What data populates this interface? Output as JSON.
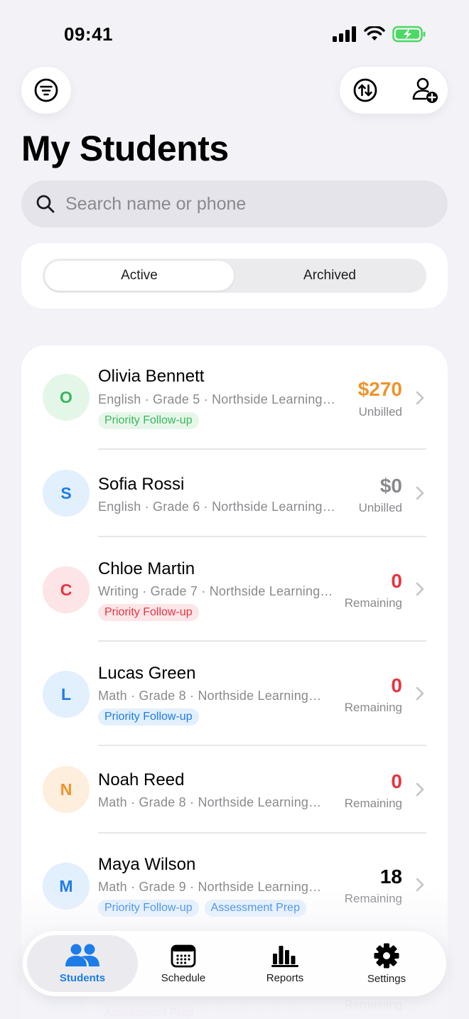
{
  "status": {
    "time": "09:41"
  },
  "header": {
    "title": "My Students"
  },
  "search": {
    "placeholder": "Search name or phone"
  },
  "segments": {
    "active": "Active",
    "archived": "Archived"
  },
  "students": [
    {
      "initial": "O",
      "name": "Olivia Bennett",
      "details": "English · Grade 5 · Northside Learning…",
      "tags": [
        "Priority Follow-up"
      ],
      "amount": "$270",
      "amount_label": "Unbilled"
    },
    {
      "initial": "S",
      "name": "Sofia Rossi",
      "details": "English · Grade 6 · Northside Learning…",
      "tags": [],
      "amount": "$0",
      "amount_label": "Unbilled"
    },
    {
      "initial": "C",
      "name": "Chloe Martin",
      "details": "Writing · Grade 7 · Northside Learning…",
      "tags": [
        "Priority Follow-up"
      ],
      "amount": "0",
      "amount_label": "Remaining"
    },
    {
      "initial": "L",
      "name": "Lucas Green",
      "details": "Math · Grade 8 · Northside Learning…",
      "tags": [
        "Priority Follow-up"
      ],
      "amount": "0",
      "amount_label": "Remaining"
    },
    {
      "initial": "N",
      "name": "Noah Reed",
      "details": "Math · Grade 8 · Northside Learning…",
      "tags": [],
      "amount": "0",
      "amount_label": "Remaining"
    },
    {
      "initial": "M",
      "name": "Maya Wilson",
      "details": "Math · Grade 9 · Northside Learning…",
      "tags": [
        "Priority Follow-up",
        "Assessment Prep"
      ],
      "amount": "18",
      "amount_label": "Remaining"
    }
  ],
  "partial_row": {
    "tag": "Assessment Prep",
    "amount_label": "Remaining"
  },
  "tabs": [
    {
      "label": "Students",
      "icon": "people-icon"
    },
    {
      "label": "Schedule",
      "icon": "calendar-icon"
    },
    {
      "label": "Reports",
      "icon": "bar-chart-icon"
    },
    {
      "label": "Settings",
      "icon": "gear-icon"
    }
  ],
  "colors": {
    "accent": "#1e7ce8",
    "orange": "#f0932b",
    "red": "#e8343f",
    "gray": "#8a8a8e",
    "green": "#3ab75b"
  }
}
